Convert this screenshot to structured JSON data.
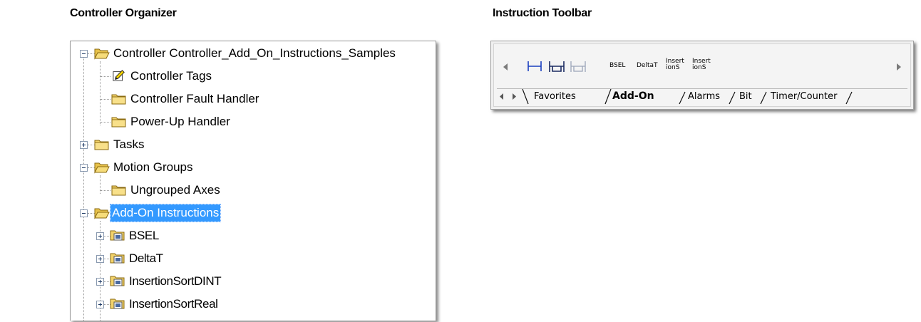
{
  "captions": {
    "organizer": "Controller Organizer",
    "toolbar": "Instruction Toolbar"
  },
  "tree": {
    "items": [
      {
        "label": "Controller Controller_Add_On_Instructions_Samples",
        "icon": "folder-open-icon",
        "expander": "minus"
      },
      {
        "label": "Controller Tags",
        "icon": "tags-icon"
      },
      {
        "label": "Controller Fault Handler",
        "icon": "folder-icon"
      },
      {
        "label": "Power-Up Handler",
        "icon": "folder-icon"
      },
      {
        "label": "Tasks",
        "icon": "folder-icon",
        "expander": "plus"
      },
      {
        "label": "Motion Groups",
        "icon": "folder-open-icon",
        "expander": "minus"
      },
      {
        "label": "Ungrouped Axes",
        "icon": "folder-icon"
      },
      {
        "label": "Add-On Instructions",
        "icon": "folder-open-icon",
        "expander": "minus",
        "selected": true
      },
      {
        "label": "BSEL",
        "icon": "aoi-icon",
        "expander": "plus"
      },
      {
        "label": "DeltaT",
        "icon": "aoi-icon",
        "expander": "plus"
      },
      {
        "label": "InsertionSortDINT",
        "icon": "aoi-icon",
        "expander": "plus"
      },
      {
        "label": "InsertionSortReal",
        "icon": "aoi-icon",
        "expander": "plus"
      }
    ],
    "selection_color": "#3399ff"
  },
  "toolbar": {
    "instructions": [
      "BSEL",
      "DeltaT",
      "Insert\nionS",
      "Insert\nionS"
    ],
    "tabs": [
      "Favorites",
      "Add-On",
      "Alarms",
      "Bit",
      "Timer/Counter"
    ],
    "active_tab": "Add-On",
    "accent_color": "#1a3fbf"
  }
}
